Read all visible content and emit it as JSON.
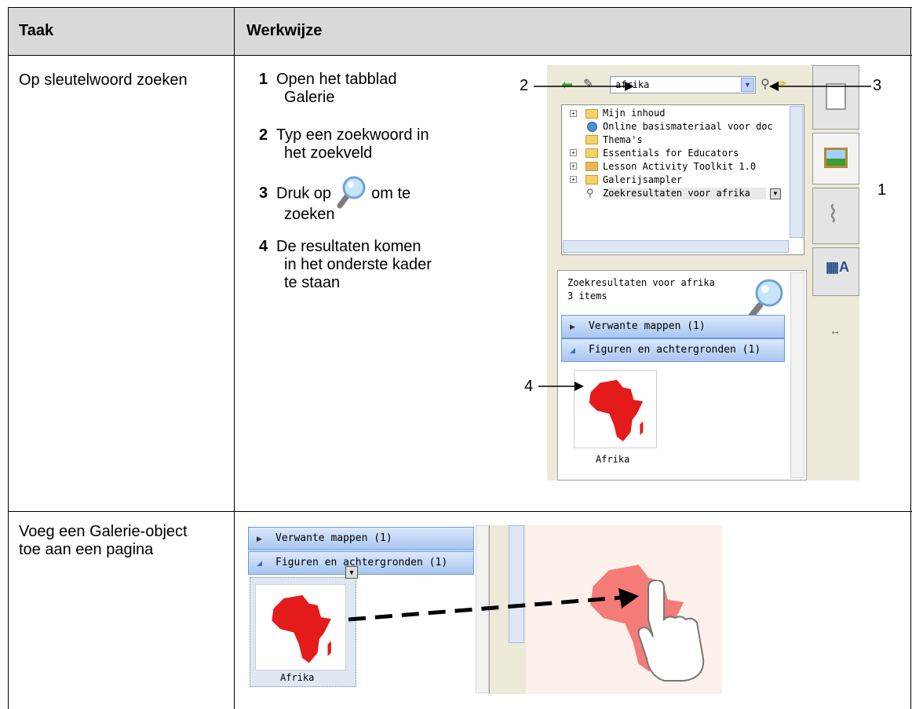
{
  "table": {
    "headers": {
      "col1": "Taak",
      "col2": "Werkwijze"
    },
    "row1": {
      "task": "Op sleutelwoord zoeken",
      "steps": [
        {
          "num": "1",
          "text1": "Open het tabblad",
          "text2": "Galerie"
        },
        {
          "num": "2",
          "text1": "Typ een zoekwoord in",
          "text2": "het zoekveld"
        },
        {
          "num": "3",
          "text1": "Druk op",
          "text_after_icon": "om te",
          "text2": "zoeken"
        },
        {
          "num": "4",
          "text1": "De resultaten komen",
          "text2": "in het onderste kader",
          "text3": "te staan"
        }
      ]
    },
    "row2": {
      "task": "Voeg een Galerie-object toe aan een pagina"
    }
  },
  "gallery": {
    "search_value": "afrika",
    "callouts": {
      "c1": "1",
      "c2": "2",
      "c3": "3",
      "c4": "4"
    },
    "tree": [
      "Mijn inhoud",
      "Online basismateriaal voor doc",
      "Thema's",
      "Essentials for Educators",
      "Lesson Activity Toolkit 1.0",
      "Galerijsampler",
      "Zoekresultaten voor afrika"
    ],
    "results_title": "Zoekresultaten voor afrika",
    "results_count": "3 items",
    "categories": [
      "Verwante mappen (1)",
      "Figuren en achtergronden (1)"
    ],
    "thumb_label": "Afrika"
  },
  "colors": {
    "header_bg": "#d9d9d9",
    "africa": "#e41b1b",
    "africa_drop": "#f47b78"
  }
}
